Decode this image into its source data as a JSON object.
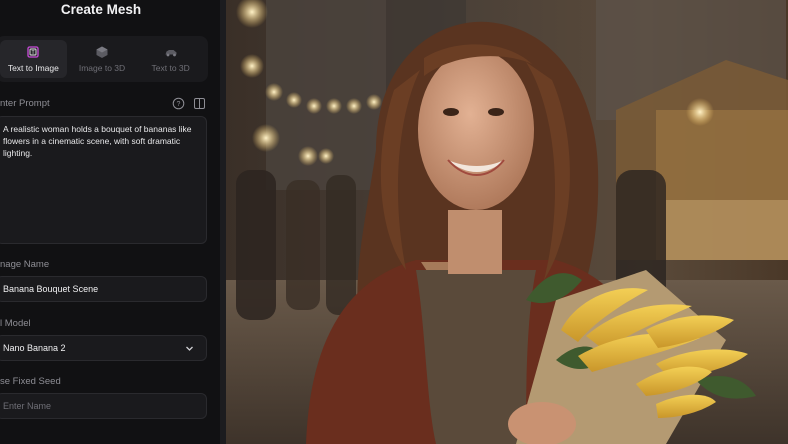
{
  "panel": {
    "title": "Create Mesh",
    "modes": [
      {
        "label": "Text to Image",
        "icon": "text-image-icon",
        "active": true
      },
      {
        "label": "Image to 3D",
        "icon": "cube-icon",
        "active": false
      },
      {
        "label": "Text to 3D",
        "icon": "car-3d-icon",
        "active": false
      }
    ],
    "prompt_label": "nter Prompt",
    "prompt_text": "A realistic woman holds a bouquet of bananas like flowers in a cinematic scene, with soft dramatic lighting.",
    "image_name_label": "nage Name",
    "image_name_value": "Banana Bouquet Scene",
    "model_label": "l Model",
    "model_value": "Nano Banana 2",
    "seed_label": "se Fixed Seed",
    "seed_placeholder": "Enter Name"
  },
  "colors": {
    "panel_bg": "#111113",
    "field_bg": "#1a1a1d",
    "accent": "#c94bd9"
  },
  "preview": {
    "description_icon": "generated-image"
  }
}
